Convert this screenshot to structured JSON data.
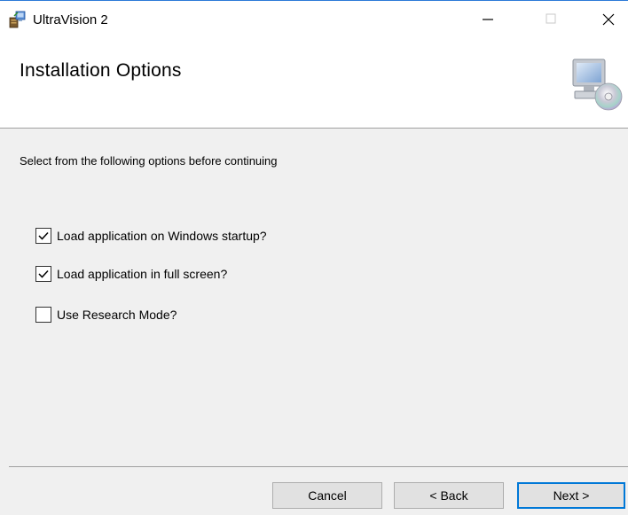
{
  "window": {
    "title": "UltraVision 2",
    "icon": "installer-icon",
    "controls": {
      "minimize": "minimize-icon",
      "maximize": "maximize-icon",
      "close": "close-icon"
    }
  },
  "header": {
    "title": "Installation Options",
    "icon": "computer-cd-icon"
  },
  "body": {
    "instruction": "Select from the following options before continuing",
    "options": [
      {
        "label": "Load application on Windows startup?",
        "checked": true
      },
      {
        "label": "Load application in full screen?",
        "checked": true
      },
      {
        "label": "Use Research Mode?",
        "checked": false
      }
    ]
  },
  "footer": {
    "cancel_label": "Cancel",
    "back_label": "< Back",
    "next_label": "Next >"
  },
  "colors": {
    "accent": "#0078d7",
    "background": "#f0f0f0",
    "header_background": "#ffffff"
  }
}
